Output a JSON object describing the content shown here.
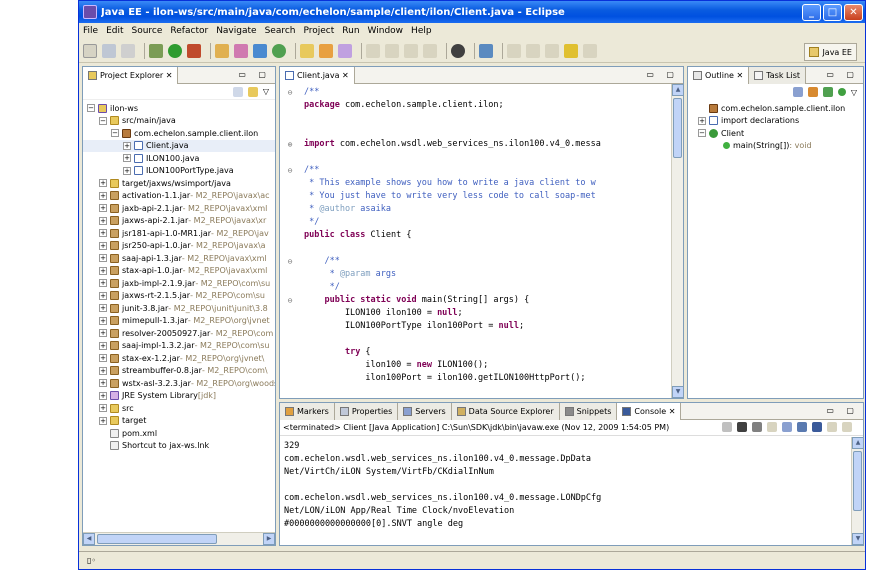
{
  "window": {
    "title": "Java EE - ilon-ws/src/main/java/com/echelon/sample/client/ilon/Client.java - Eclipse",
    "min": "_",
    "max": "□",
    "close": "✕"
  },
  "menu": [
    "File",
    "Edit",
    "Source",
    "Refactor",
    "Navigate",
    "Search",
    "Project",
    "Run",
    "Window",
    "Help"
  ],
  "perspective": "Java EE",
  "project_explorer": {
    "tab": "Project Explorer",
    "tab_close": "✕",
    "items": [
      {
        "indent": 0,
        "exp": "-",
        "icon": "proj",
        "label": "ilon-ws",
        "extra": ""
      },
      {
        "indent": 1,
        "exp": "-",
        "icon": "fold",
        "label": "src/main/java",
        "extra": ""
      },
      {
        "indent": 2,
        "exp": "-",
        "icon": "pkg",
        "label": "com.echelon.sample.client.ilon",
        "extra": ""
      },
      {
        "indent": 3,
        "exp": "+",
        "icon": "java",
        "label": "Client.java",
        "extra": ""
      },
      {
        "indent": 3,
        "exp": "+",
        "icon": "java",
        "label": "ILON100.java",
        "extra": ""
      },
      {
        "indent": 3,
        "exp": "+",
        "icon": "java",
        "label": "ILON100PortType.java",
        "extra": ""
      },
      {
        "indent": 1,
        "exp": "+",
        "icon": "fold",
        "label": "target/jaxws/wsimport/java",
        "extra": ""
      },
      {
        "indent": 1,
        "exp": "+",
        "icon": "jar",
        "label": "activation-1.1.jar",
        "extra": " - M2_REPO\\javax\\ac"
      },
      {
        "indent": 1,
        "exp": "+",
        "icon": "jar",
        "label": "jaxb-api-2.1.jar",
        "extra": " - M2_REPO\\javax\\xml"
      },
      {
        "indent": 1,
        "exp": "+",
        "icon": "jar",
        "label": "jaxws-api-2.1.jar",
        "extra": " - M2_REPO\\javax\\xr"
      },
      {
        "indent": 1,
        "exp": "+",
        "icon": "jar",
        "label": "jsr181-api-1.0-MR1.jar",
        "extra": " - M2_REPO\\jav"
      },
      {
        "indent": 1,
        "exp": "+",
        "icon": "jar",
        "label": "jsr250-api-1.0.jar",
        "extra": " - M2_REPO\\javax\\a"
      },
      {
        "indent": 1,
        "exp": "+",
        "icon": "jar",
        "label": "saaj-api-1.3.jar",
        "extra": " - M2_REPO\\javax\\xml"
      },
      {
        "indent": 1,
        "exp": "+",
        "icon": "jar",
        "label": "stax-api-1.0.jar",
        "extra": " - M2_REPO\\javax\\xml"
      },
      {
        "indent": 1,
        "exp": "+",
        "icon": "jar",
        "label": "jaxb-impl-2.1.9.jar",
        "extra": " - M2_REPO\\com\\su"
      },
      {
        "indent": 1,
        "exp": "+",
        "icon": "jar",
        "label": "jaxws-rt-2.1.5.jar",
        "extra": " - M2_REPO\\com\\su"
      },
      {
        "indent": 1,
        "exp": "+",
        "icon": "jar",
        "label": "junit-3.8.jar",
        "extra": " - M2_REPO\\junit\\junit\\3.8"
      },
      {
        "indent": 1,
        "exp": "+",
        "icon": "jar",
        "label": "mimepull-1.3.jar",
        "extra": " - M2_REPO\\org\\jvnet"
      },
      {
        "indent": 1,
        "exp": "+",
        "icon": "jar",
        "label": "resolver-20050927.jar",
        "extra": " - M2_REPO\\com"
      },
      {
        "indent": 1,
        "exp": "+",
        "icon": "jar",
        "label": "saaj-impl-1.3.2.jar",
        "extra": " - M2_REPO\\com\\su"
      },
      {
        "indent": 1,
        "exp": "+",
        "icon": "jar",
        "label": "stax-ex-1.2.jar",
        "extra": " - M2_REPO\\org\\jvnet\\"
      },
      {
        "indent": 1,
        "exp": "+",
        "icon": "jar",
        "label": "streambuffer-0.8.jar",
        "extra": " - M2_REPO\\com\\"
      },
      {
        "indent": 1,
        "exp": "+",
        "icon": "jar",
        "label": "wstx-asl-3.2.3.jar",
        "extra": " - M2_REPO\\org\\woodst"
      },
      {
        "indent": 1,
        "exp": "+",
        "icon": "lib",
        "label": "JRE System Library",
        "extra": " [jdk]"
      },
      {
        "indent": 1,
        "exp": "+",
        "icon": "fold",
        "label": "src",
        "extra": ""
      },
      {
        "indent": 1,
        "exp": "+",
        "icon": "fold",
        "label": "target",
        "extra": ""
      },
      {
        "indent": 1,
        "exp": "",
        "icon": "xml",
        "label": "pom.xml",
        "extra": ""
      },
      {
        "indent": 1,
        "exp": "",
        "icon": "xml",
        "label": "Shortcut to jax-ws.lnk",
        "extra": ""
      }
    ]
  },
  "editor": {
    "tab": "Client.java",
    "tab_close": "✕",
    "lines": [
      {
        "g": "⊖",
        "parts": [
          [
            "cm",
            "/**"
          ],
          [
            "",
            ""
          ]
        ]
      },
      {
        "g": "",
        "parts": [
          [
            "kw",
            "package"
          ],
          [
            "",
            " com.echelon.sample.client.ilon;"
          ]
        ]
      },
      {
        "g": "",
        "parts": [
          [
            "",
            ""
          ]
        ]
      },
      {
        "g": "",
        "parts": [
          [
            "",
            ""
          ]
        ]
      },
      {
        "g": "⊕",
        "parts": [
          [
            "kw",
            "import"
          ],
          [
            "",
            " com.echelon.wsdl.web_services_ns.ilon100.v4_0.messa"
          ]
        ]
      },
      {
        "g": "",
        "parts": [
          [
            "",
            ""
          ]
        ]
      },
      {
        "g": "⊖",
        "parts": [
          [
            "cm",
            "/**"
          ]
        ]
      },
      {
        "g": "",
        "parts": [
          [
            "cm",
            " * This example shows you how to write a java client to w"
          ]
        ]
      },
      {
        "g": "",
        "parts": [
          [
            "cm",
            " * You just have to write very less code to call soap-met"
          ]
        ]
      },
      {
        "g": "",
        "parts": [
          [
            "cm",
            " * "
          ],
          [
            "tg",
            "@author"
          ],
          [
            "cm",
            " asaika"
          ]
        ]
      },
      {
        "g": "",
        "parts": [
          [
            "cm",
            " */"
          ]
        ]
      },
      {
        "g": "",
        "parts": [
          [
            "kw",
            "public class"
          ],
          [
            "",
            " Client {"
          ]
        ]
      },
      {
        "g": "",
        "parts": [
          [
            "",
            ""
          ]
        ]
      },
      {
        "g": "⊖",
        "parts": [
          [
            "cm",
            "    /**"
          ]
        ]
      },
      {
        "g": "",
        "parts": [
          [
            "cm",
            "     * "
          ],
          [
            "tg",
            "@param"
          ],
          [
            "cm",
            " args"
          ]
        ]
      },
      {
        "g": "",
        "parts": [
          [
            "cm",
            "     */"
          ]
        ]
      },
      {
        "g": "⊖",
        "parts": [
          [
            "",
            "    "
          ],
          [
            "kw",
            "public static void"
          ],
          [
            "",
            " main(String[] args) {"
          ]
        ]
      },
      {
        "g": "",
        "parts": [
          [
            "",
            "        ILON100 ilon100 = "
          ],
          [
            "kw",
            "null"
          ],
          [
            "",
            ";"
          ]
        ]
      },
      {
        "g": "",
        "parts": [
          [
            "",
            "        ILON100PortType ilon100Port = "
          ],
          [
            "kw",
            "null"
          ],
          [
            "",
            ";"
          ]
        ]
      },
      {
        "g": "",
        "parts": [
          [
            "",
            ""
          ]
        ]
      },
      {
        "g": "",
        "parts": [
          [
            "",
            "        "
          ],
          [
            "kw",
            "try"
          ],
          [
            "",
            " {"
          ]
        ]
      },
      {
        "g": "",
        "parts": [
          [
            "",
            "            ilon100 = "
          ],
          [
            "kw",
            "new"
          ],
          [
            "",
            " ILON100();"
          ]
        ]
      },
      {
        "g": "",
        "parts": [
          [
            "",
            "            ilon100Port = ilon100.getILON100HttpPort();"
          ]
        ]
      }
    ]
  },
  "outline": {
    "tab": "Outline",
    "tab_close": "✕",
    "tab2": "Task List",
    "items": [
      {
        "indent": 0,
        "icon": "pkg",
        "label": "com.echelon.sample.client.ilon",
        "exp": ""
      },
      {
        "indent": 0,
        "icon": "java",
        "label": "import declarations",
        "exp": "+"
      },
      {
        "indent": 0,
        "icon": "class",
        "label": "Client",
        "exp": "-"
      },
      {
        "indent": 1,
        "icon": "method",
        "label": "main(String[])",
        "suffix": " : void",
        "exp": ""
      }
    ]
  },
  "console": {
    "tabs": [
      "Markers",
      "Properties",
      "Servers",
      "Data Source Explorer",
      "Snippets",
      "Console"
    ],
    "tab_close": "✕",
    "terminated": "<terminated> Client [Java Application] C:\\Sun\\SDK\\jdk\\bin\\javaw.exe (Nov 12, 2009 1:54:05 PM)",
    "lines": [
      "329",
      "com.echelon.wsdl.web_services_ns.ilon100.v4_0.message.DpData",
      "Net/VirtCh/iLON System/VirtFb/CKdialInNum",
      "",
      "com.echelon.wsdl.web_services_ns.ilon100.v4_0.message.LONDpCfg",
      "Net/LON/iLON App/Real Time Clock/nvoElevation",
      "#0000000000000000[0].SNVT angle deg"
    ]
  },
  "status": "▯◦"
}
